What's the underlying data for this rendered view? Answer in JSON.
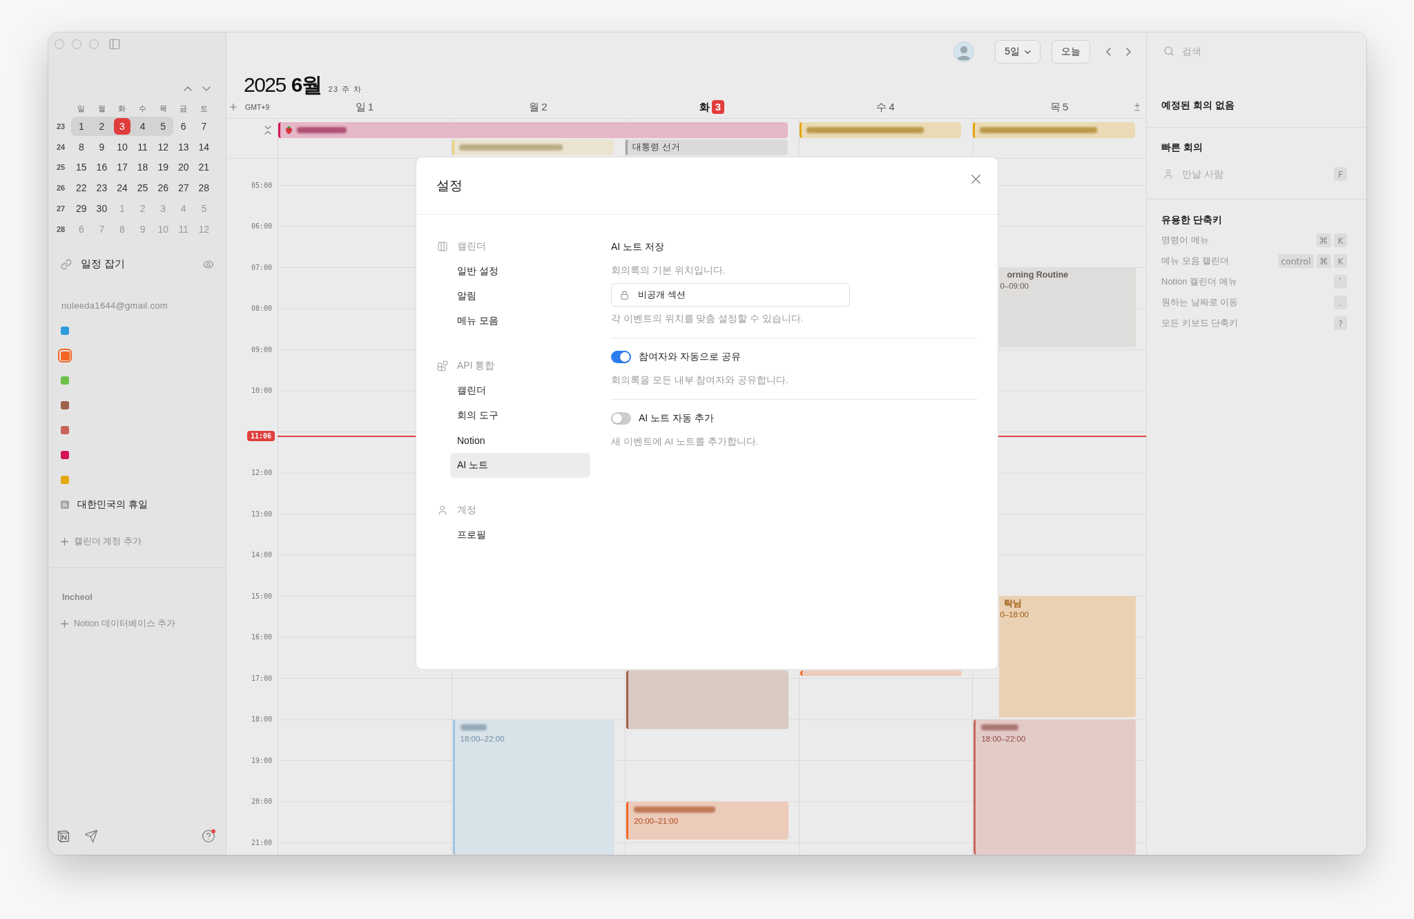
{
  "sidebar": {
    "mini_calendar": {
      "weekdays": [
        "일",
        "월",
        "화",
        "수",
        "목",
        "금",
        "토"
      ],
      "weeks": [
        {
          "number": "23",
          "days": [
            {
              "label": "1",
              "kind": "day",
              "in_range": true
            },
            {
              "label": "2",
              "kind": "day",
              "in_range": true
            },
            {
              "label": "3",
              "kind": "today",
              "in_range": true
            },
            {
              "label": "4",
              "kind": "day",
              "in_range": true
            },
            {
              "label": "5",
              "kind": "day",
              "in_range": true
            },
            {
              "label": "6",
              "kind": "day",
              "in_range": false
            },
            {
              "label": "7",
              "kind": "day",
              "in_range": false
            }
          ]
        },
        {
          "number": "24",
          "days": [
            {
              "label": "8",
              "kind": "day",
              "in_range": false
            },
            {
              "label": "9",
              "kind": "day",
              "in_range": false
            },
            {
              "label": "10",
              "kind": "day",
              "in_range": false
            },
            {
              "label": "11",
              "kind": "day",
              "in_range": false
            },
            {
              "label": "12",
              "kind": "day",
              "in_range": false
            },
            {
              "label": "13",
              "kind": "day",
              "in_range": false
            },
            {
              "label": "14",
              "kind": "day",
              "in_range": false
            }
          ]
        },
        {
          "number": "25",
          "days": [
            {
              "label": "15",
              "kind": "day",
              "in_range": false
            },
            {
              "label": "16",
              "kind": "day",
              "in_range": false
            },
            {
              "label": "17",
              "kind": "day",
              "in_range": false
            },
            {
              "label": "18",
              "kind": "day",
              "in_range": false
            },
            {
              "label": "19",
              "kind": "day",
              "in_range": false
            },
            {
              "label": "20",
              "kind": "day",
              "in_range": false
            },
            {
              "label": "21",
              "kind": "day",
              "in_range": false
            }
          ]
        },
        {
          "number": "26",
          "days": [
            {
              "label": "22",
              "kind": "day",
              "in_range": false
            },
            {
              "label": "23",
              "kind": "day",
              "in_range": false
            },
            {
              "label": "24",
              "kind": "day",
              "in_range": false
            },
            {
              "label": "25",
              "kind": "day",
              "in_range": false
            },
            {
              "label": "26",
              "kind": "day",
              "in_range": false
            },
            {
              "label": "27",
              "kind": "day",
              "in_range": false
            },
            {
              "label": "28",
              "kind": "day",
              "in_range": false
            }
          ]
        },
        {
          "number": "27",
          "days": [
            {
              "label": "29",
              "kind": "day",
              "in_range": false
            },
            {
              "label": "30",
              "kind": "day",
              "in_range": false
            },
            {
              "label": "1",
              "kind": "other_month",
              "in_range": false
            },
            {
              "label": "2",
              "kind": "other_month",
              "in_range": false
            },
            {
              "label": "3",
              "kind": "other_month",
              "in_range": false
            },
            {
              "label": "4",
              "kind": "other_month",
              "in_range": false
            },
            {
              "label": "5",
              "kind": "other_month",
              "in_range": false
            }
          ]
        },
        {
          "number": "28",
          "days": [
            {
              "label": "6",
              "kind": "other_month",
              "in_range": false
            },
            {
              "label": "7",
              "kind": "other_month",
              "in_range": false
            },
            {
              "label": "8",
              "kind": "other_month",
              "in_range": false
            },
            {
              "label": "9",
              "kind": "other_month",
              "in_range": false
            },
            {
              "label": "10",
              "kind": "other_month",
              "in_range": false
            },
            {
              "label": "11",
              "kind": "other_month",
              "in_range": false
            },
            {
              "label": "12",
              "kind": "other_month",
              "in_range": false
            }
          ]
        }
      ]
    },
    "scheduling_link": {
      "label": "일정 잡기"
    },
    "account": {
      "email": "nuleeda1644@gmail.com",
      "calendars": [
        {
          "color": "#2f9bdf",
          "selected": false
        },
        {
          "color": "#f26522",
          "selected": true
        },
        {
          "color": "#6cc04a",
          "selected": false
        },
        {
          "color": "#a0614a",
          "selected": false
        },
        {
          "color": "#c9645a",
          "selected": false
        },
        {
          "color": "#d4145a",
          "selected": false
        },
        {
          "color": "#e6a80c",
          "selected": false
        }
      ]
    },
    "subscribed_calendar": {
      "label": "대한민국의 휴일"
    },
    "add_calendar_account": {
      "label": "캘린더 계정 추가"
    },
    "notion": {
      "workspace": "Incheol",
      "add_database": {
        "label": "Notion 데이터베이스 추가"
      }
    }
  },
  "toolbar": {
    "view_menu": {
      "label": "5일"
    },
    "today_button": {
      "label": "오늘"
    }
  },
  "header": {
    "year": "2025",
    "month": "6월",
    "week": "23 주 차",
    "timezone": "GMT+9",
    "days": [
      {
        "weekday": "일",
        "date": "1",
        "today": false
      },
      {
        "weekday": "월",
        "date": "2",
        "today": false
      },
      {
        "weekday": "화",
        "date": "3",
        "today": true
      },
      {
        "weekday": "수",
        "date": "4",
        "today": false
      },
      {
        "weekday": "목",
        "date": "5",
        "today": false
      }
    ]
  },
  "all_day_events": [
    {
      "kind": "emoji_blurred",
      "color": "#d4145a"
    },
    {
      "kind": "blurred",
      "color": "#e5a50a"
    },
    {
      "kind": "blurred",
      "color": "#e5a50a"
    },
    {
      "kind": "blurred",
      "color": "#e8cf7e"
    },
    {
      "kind": "titled",
      "title": "대통령 선거",
      "color": "#a3a3a3"
    }
  ],
  "time_grid": {
    "gutter": [
      {
        "kind": "hour",
        "label": "05:00"
      },
      {
        "kind": "hour",
        "label": "06:00"
      },
      {
        "kind": "hour",
        "label": "07:00"
      },
      {
        "kind": "hour",
        "label": "08:00"
      },
      {
        "kind": "hour",
        "label": "09:00"
      },
      {
        "kind": "hour",
        "label": "10:00"
      },
      {
        "kind": "now",
        "label": "11:06"
      },
      {
        "kind": "hour",
        "label": "12:00"
      },
      {
        "kind": "hour",
        "label": "13:00"
      },
      {
        "kind": "hour",
        "label": "14:00"
      },
      {
        "kind": "hour",
        "label": "15:00"
      },
      {
        "kind": "hour",
        "label": "16:00"
      },
      {
        "kind": "hour",
        "label": "17:00"
      },
      {
        "kind": "hour",
        "label": "18:00"
      },
      {
        "kind": "hour",
        "label": "19:00"
      },
      {
        "kind": "hour",
        "label": "20:00"
      },
      {
        "kind": "hour",
        "label": "21:00"
      }
    ],
    "events": [
      {
        "kind": "blurred",
        "time": "18:00–22:00",
        "color": "#9cc6e2"
      },
      {
        "kind": "plain",
        "color": "#a0614a"
      },
      {
        "kind": "blurred",
        "time": "20:00–21:00",
        "color": "#f26522"
      },
      {
        "kind": "plain",
        "color": "#f26522"
      },
      {
        "kind": "titled",
        "title": "orning Routine",
        "time": "0–09:00",
        "color": "#dfdddb"
      },
      {
        "kind": "titled",
        "title": "락님",
        "time": "0–18:00",
        "color": "#ebd1b4"
      },
      {
        "kind": "blurred",
        "time": "18:00–22:00",
        "color": "#c9645a"
      }
    ]
  },
  "right_panel": {
    "search": {
      "placeholder": "검색"
    },
    "upcoming": {
      "title": "예정된 회의 없음"
    },
    "quick_meeting": {
      "title": "빠른 회의",
      "field": {
        "placeholder": "만날 사람"
      },
      "keys": [
        "F"
      ]
    },
    "shortcuts": {
      "title": "유용한 단축키",
      "items": [
        {
          "label": "명령어 메뉴",
          "keys": [
            "⌘",
            "K"
          ]
        },
        {
          "label": "메뉴 모음 캘린더",
          "keys": [
            "control",
            "⌘",
            "K"
          ]
        },
        {
          "label": "Notion 캘린더 메뉴",
          "keys": [
            "`"
          ]
        },
        {
          "label": "원하는 날짜로 이동",
          "keys": [
            "."
          ]
        },
        {
          "label": "모든 키보드 단축키",
          "keys": [
            "?"
          ]
        }
      ]
    }
  },
  "settings_dialog": {
    "title": "설정",
    "nav": [
      {
        "heading": "캘린더",
        "items": [
          {
            "label": "일반 설정",
            "selected": false
          },
          {
            "label": "알림",
            "selected": false
          },
          {
            "label": "메뉴 모음",
            "selected": false
          }
        ]
      },
      {
        "heading": "API 통합",
        "items": [
          {
            "label": "캘린더",
            "selected": false
          },
          {
            "label": "회의 도구",
            "selected": false
          },
          {
            "label": "Notion",
            "selected": false
          },
          {
            "label": "AI 노트",
            "selected": true
          }
        ]
      },
      {
        "heading": "계정",
        "items": [
          {
            "label": "프로필",
            "selected": false
          }
        ]
      }
    ],
    "content": {
      "title": "AI 노트 저장",
      "description": "회의록의 기본 위치입니다.",
      "location_field": {
        "value": "비공개 섹션"
      },
      "hint": "각 이벤트의 위치를 맞춤 설정할 수 있습니다.",
      "toggles": [
        {
          "label": "참여자와 자동으로 공유",
          "description": "회의록을 모든 내부 참여자와 공유합니다.",
          "on": true
        },
        {
          "label": "AI 노트 자동 추가",
          "description": "새 이벤트에 AI 노트를 추가합니다.",
          "on": false
        }
      ]
    }
  }
}
